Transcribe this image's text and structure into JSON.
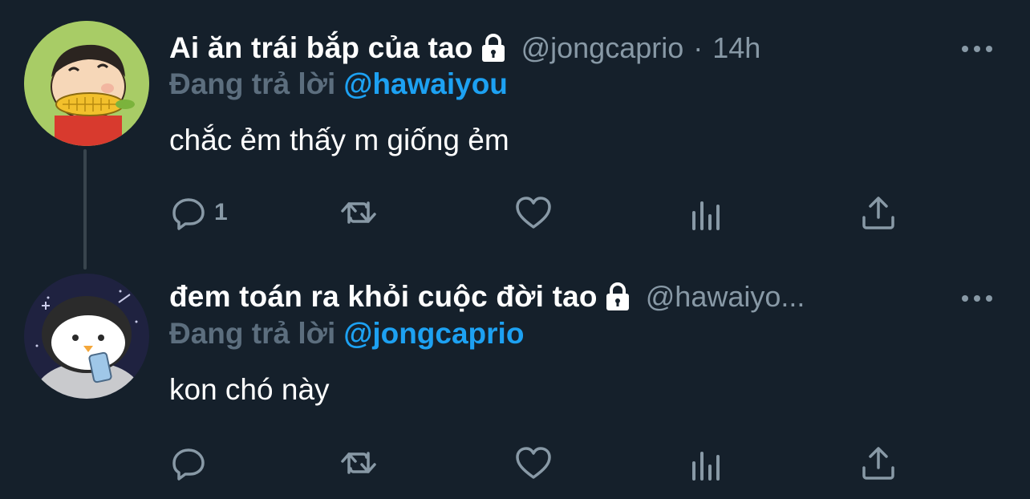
{
  "tweets": [
    {
      "display_name": "Ai ăn trái bắp của tao",
      "handle": "@jongcaprio",
      "separator": "·",
      "time": "14h",
      "reply_prefix": "Đang trả lời",
      "reply_to": "@hawaiyou",
      "text": "chắc ẻm thấy m giống ẻm",
      "reply_count": "1",
      "avatar": "cartoon-boy-with-corn"
    },
    {
      "display_name": "đem toán ra khỏi cuộc đời tao",
      "handle": "@hawaiyo...",
      "reply_prefix": "Đang trả lời",
      "reply_to": "@jongcaprio",
      "text": "kon chó này",
      "reply_count": "",
      "avatar": "penguin-with-phone"
    }
  ],
  "icons": {
    "lock": "lock-icon",
    "more": "more-icon",
    "reply": "reply-icon",
    "retweet": "retweet-icon",
    "like": "heart-icon",
    "views": "analytics-icon",
    "share": "share-icon"
  },
  "colors": {
    "background": "#15202b",
    "text": "#ffffff",
    "muted": "#8899a6",
    "link": "#1da1f2",
    "thread_line": "#38444d"
  }
}
